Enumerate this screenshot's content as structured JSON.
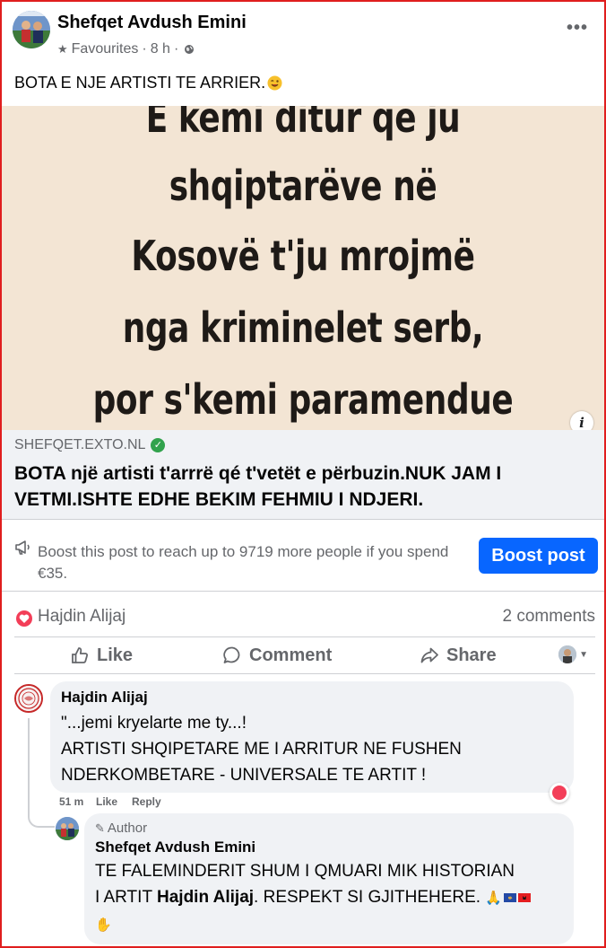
{
  "post": {
    "author": "Shefqet Avdush Emini",
    "audience_label": "Favourites",
    "time": "8 h",
    "separator": "·",
    "text": "BOTA E NJE ARTISTI TE ARRIER.",
    "more_label": "•••"
  },
  "image": {
    "lines": [
      "E kemi ditur që ju",
      "shqiptarëve në",
      "Kosovë t'ju mrojmë",
      "nga kriminelet serb,",
      "por s'kemi paramendue"
    ],
    "background_color": "#f3e5d4",
    "info_label": "i"
  },
  "link": {
    "domain": "SHEFQET.EXTO.NL",
    "title": "BOTA një artisti t'arrrë qé t'vetët e përbuzin.NUK JAM I VETMI.ISHTE EDHE BEKIM FEHMIU I NDJERI."
  },
  "boost": {
    "text": "Boost this post to reach up to 9719 more people if you spend €35.",
    "button_label": "Boost post",
    "button_color": "#0866ff"
  },
  "reactions": {
    "reactor": "Hajdin Alijaj",
    "comments_count": "2 comments",
    "love_color": "#f33e58"
  },
  "actions": {
    "like": "Like",
    "comment": "Comment",
    "share": "Share"
  },
  "comments": [
    {
      "author": "Hajdin Alijaj",
      "lines": [
        "\"...jemi kryelarte me ty...!",
        "ARTISTI SHQIPETARE ME I ARRITUR NE FUSHEN",
        "NDERKOMBETARE - UNIVERSALE TE ARTIT !"
      ],
      "time": "51 m",
      "like_label": "Like",
      "reply_label": "Reply"
    },
    {
      "badge": "Author",
      "author": "Shefqet Avdush Emini",
      "line1": "TE FALEMINDERIT SHUM I QMUARI MIK HISTORIAN",
      "line2_prefix": "I ARTIT ",
      "line2_bold": "Hajdin Alijaj",
      "line2_suffix": ". RESPEKT SI GJITHEHERE.",
      "emoji_line2": "🙏",
      "emoji_line3": "✋"
    }
  ]
}
